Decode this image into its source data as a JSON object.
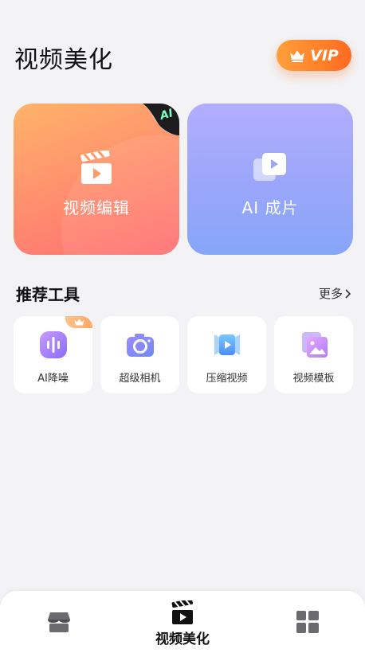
{
  "header": {
    "title": "视频美化",
    "vip_label": "VIP"
  },
  "cards": [
    {
      "label": "视频编辑",
      "badge": "AI"
    },
    {
      "label": "AI 成片"
    }
  ],
  "section": {
    "title": "推荐工具",
    "more_label": "更多"
  },
  "tools": [
    {
      "label": "AI降噪",
      "vip": true
    },
    {
      "label": "超级相机"
    },
    {
      "label": "压缩视频"
    },
    {
      "label": "视频模板"
    }
  ],
  "tabbar": {
    "active_label": "视频美化"
  },
  "colors": {
    "vip_orange": "#ff7a25",
    "edit_card": "#ff8c6e",
    "ai_card": "#9aa6fa",
    "bg": "#f3f3f6"
  }
}
